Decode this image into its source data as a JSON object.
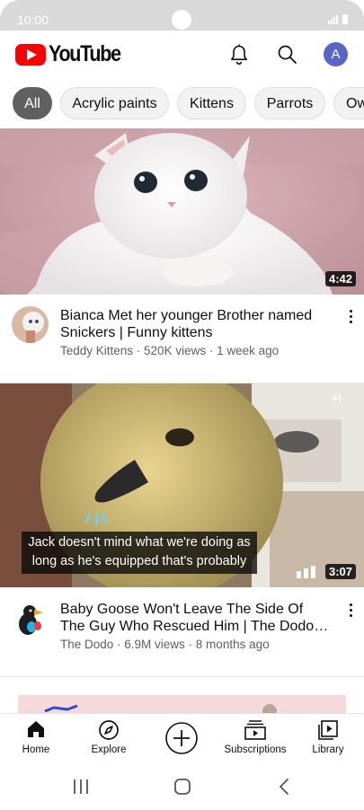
{
  "status_bar": {
    "time": "10:00"
  },
  "header": {
    "app_name": "YouTube",
    "avatar_letter": "A"
  },
  "chips": [
    {
      "label": "All",
      "active": true
    },
    {
      "label": "Acrylic paints",
      "active": false
    },
    {
      "label": "Kittens",
      "active": false
    },
    {
      "label": "Parrots",
      "active": false
    },
    {
      "label": "Ow",
      "active": false
    }
  ],
  "videos": [
    {
      "title": "Bianca Met her younger Brother named Snickers | Funny kittens",
      "channel": "Teddy Kittens",
      "views": "520K views",
      "age": "1 week ago",
      "meta": "Teddy Kittens · 520K views · 1 week ago",
      "duration": "4:42"
    },
    {
      "title": "Baby Goose Won't Leave The Side Of The Guy Who Rescued Him | The Dodo Little ...",
      "channel": "The Dodo",
      "views": "6.9M views",
      "age": "8 months ago",
      "meta": "The Dodo · 6.9M views · 8 months ago",
      "duration": "3:07",
      "caption_line1": "Jack doesn't mind what we're doing as",
      "caption_line2": "long as he's equipped that's probably"
    }
  ],
  "bottom_nav": {
    "home": "Home",
    "explore": "Explore",
    "subscriptions": "Subscriptions",
    "library": "Library"
  },
  "colors": {
    "brand_red": "#ff0000",
    "avatar_bg": "#5a65c8",
    "active_chip": "#606060"
  }
}
